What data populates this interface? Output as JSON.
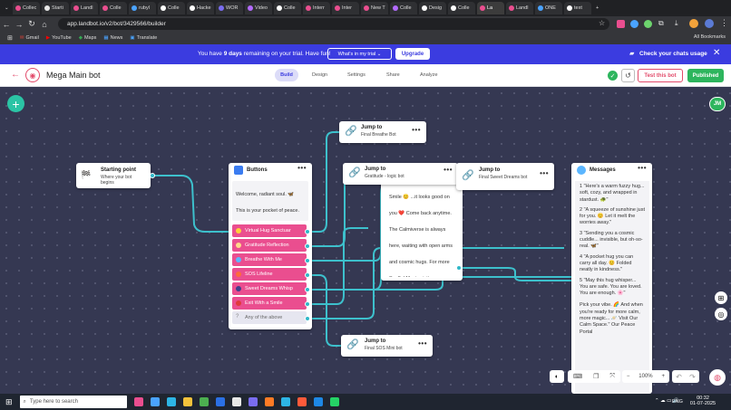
{
  "browser": {
    "tabs": [
      {
        "label": "Collec",
        "color": "#ea4e8f"
      },
      {
        "label": "Starti",
        "color": "#e7e7e7"
      },
      {
        "label": "Landl",
        "color": "#ea4e8f"
      },
      {
        "label": "Colle",
        "color": "#ea4e8f"
      },
      {
        "label": "rubyl",
        "color": "#4aa3ff"
      },
      {
        "label": "Colle",
        "color": "#ffffff"
      },
      {
        "label": "Hacke",
        "color": "#ffffff"
      },
      {
        "label": "WOR",
        "color": "#7a6df0"
      },
      {
        "label": "Video",
        "color": "#b36bff"
      },
      {
        "label": "Colle",
        "color": "#ffffff"
      },
      {
        "label": "Interr",
        "color": "#ea4e8f"
      },
      {
        "label": "Inter",
        "color": "#ea4e8f"
      },
      {
        "label": "New T",
        "color": "#ea4e8f"
      },
      {
        "label": "Colle",
        "color": "#b36bff"
      },
      {
        "label": "Desig",
        "color": "#ffffff"
      },
      {
        "label": "Colle",
        "color": "#ffffff"
      },
      {
        "label": "La",
        "color": "#ea4e8f"
      },
      {
        "label": "Landl",
        "color": "#ea4e8f"
      },
      {
        "label": "ONE",
        "color": "#4aa3ff"
      },
      {
        "label": "text",
        "color": "#ffffff"
      }
    ],
    "url": "app.landbot.io/v2/bot/3429566/builder",
    "bookmarks": [
      "Gmail",
      "YouTube",
      "Maps",
      "News",
      "Translate"
    ],
    "all_bookmarks": "All Bookmarks"
  },
  "banner": {
    "text_pre": "You have ",
    "days": "9 days",
    "text_post": " remaining on your trial. Have fun!",
    "whats_in_trial": "What's in my trial",
    "upgrade": "Upgrade",
    "check_usage": "Check your chats usage"
  },
  "header": {
    "bot_name": "Mega Main bot",
    "nav": [
      "Build",
      "Design",
      "Settings",
      "Share",
      "Analyze"
    ],
    "test_bot": "Test this bot",
    "published": "Published",
    "avatar": "JM"
  },
  "nodes": {
    "start": {
      "title": "Starting point",
      "sub": "Where your bot begins"
    },
    "buttons": {
      "title": "Buttons",
      "message": "Welcome, radiant soul. 🦋 This is your pocket of peace. Where would you like to go today?",
      "options": [
        "Virtual Hug Sanctuar",
        "Gratitude Reflection",
        "Breathe With Me",
        "SOS Lifeline",
        "Sweet Dreams Whisp",
        "Exit With a Smile"
      ],
      "any": "Any of the above"
    },
    "jump_breathe": {
      "title": "Jump to",
      "sub": "Final Breathe Bot"
    },
    "jump_gratitude": {
      "title": "Jump to",
      "sub": "Gratitude - logic bot"
    },
    "jump_sweet": {
      "title": "Jump to",
      "sub": "Final Sweet Dreams bot"
    },
    "jump_sos": {
      "title": "Jump to",
      "sub": "Final SOS Mini bot"
    },
    "exit_msg": {
      "text": "Smile 😊 ...it looks good on you ❤️ Come back anytime. The Calmiverse is always here, waiting with open arms and cosmic hugs. For more Soulful Magic visit our website https://peppy-meringue-f65ca8.netlify.app/ Thank you for visiting Collective Calm Bot 💜"
    },
    "messages": {
      "title": "Messages",
      "items": [
        "1 \"Here's a warm fuzzy hug... soft, cozy, and wrapped in stardust. 🐢\"",
        "2 \"A squeeze of sunshine just for you. 😊 Let it melt the worries away.\"",
        "3 \"Sending you a cosmic cuddle... invisible, but oh-so-real. 🦋\"",
        "4 \"A pocket hug you can carry all day. 😊 Folded neatly in kindness.\"",
        "5 \"May this hug whisper... You are safe. You are loved. You are enough. 🌸\""
      ],
      "outro": "Pick your vibe. 🌈 And when you're ready for more calm, more magic... 🪐 Visit Our Calm Space.\" Our Peace Portal"
    }
  },
  "zoom": "100%",
  "taskbar": {
    "search": "Type here to search",
    "lang": "ENG",
    "time": "00:32",
    "date": "01-07-2025"
  }
}
